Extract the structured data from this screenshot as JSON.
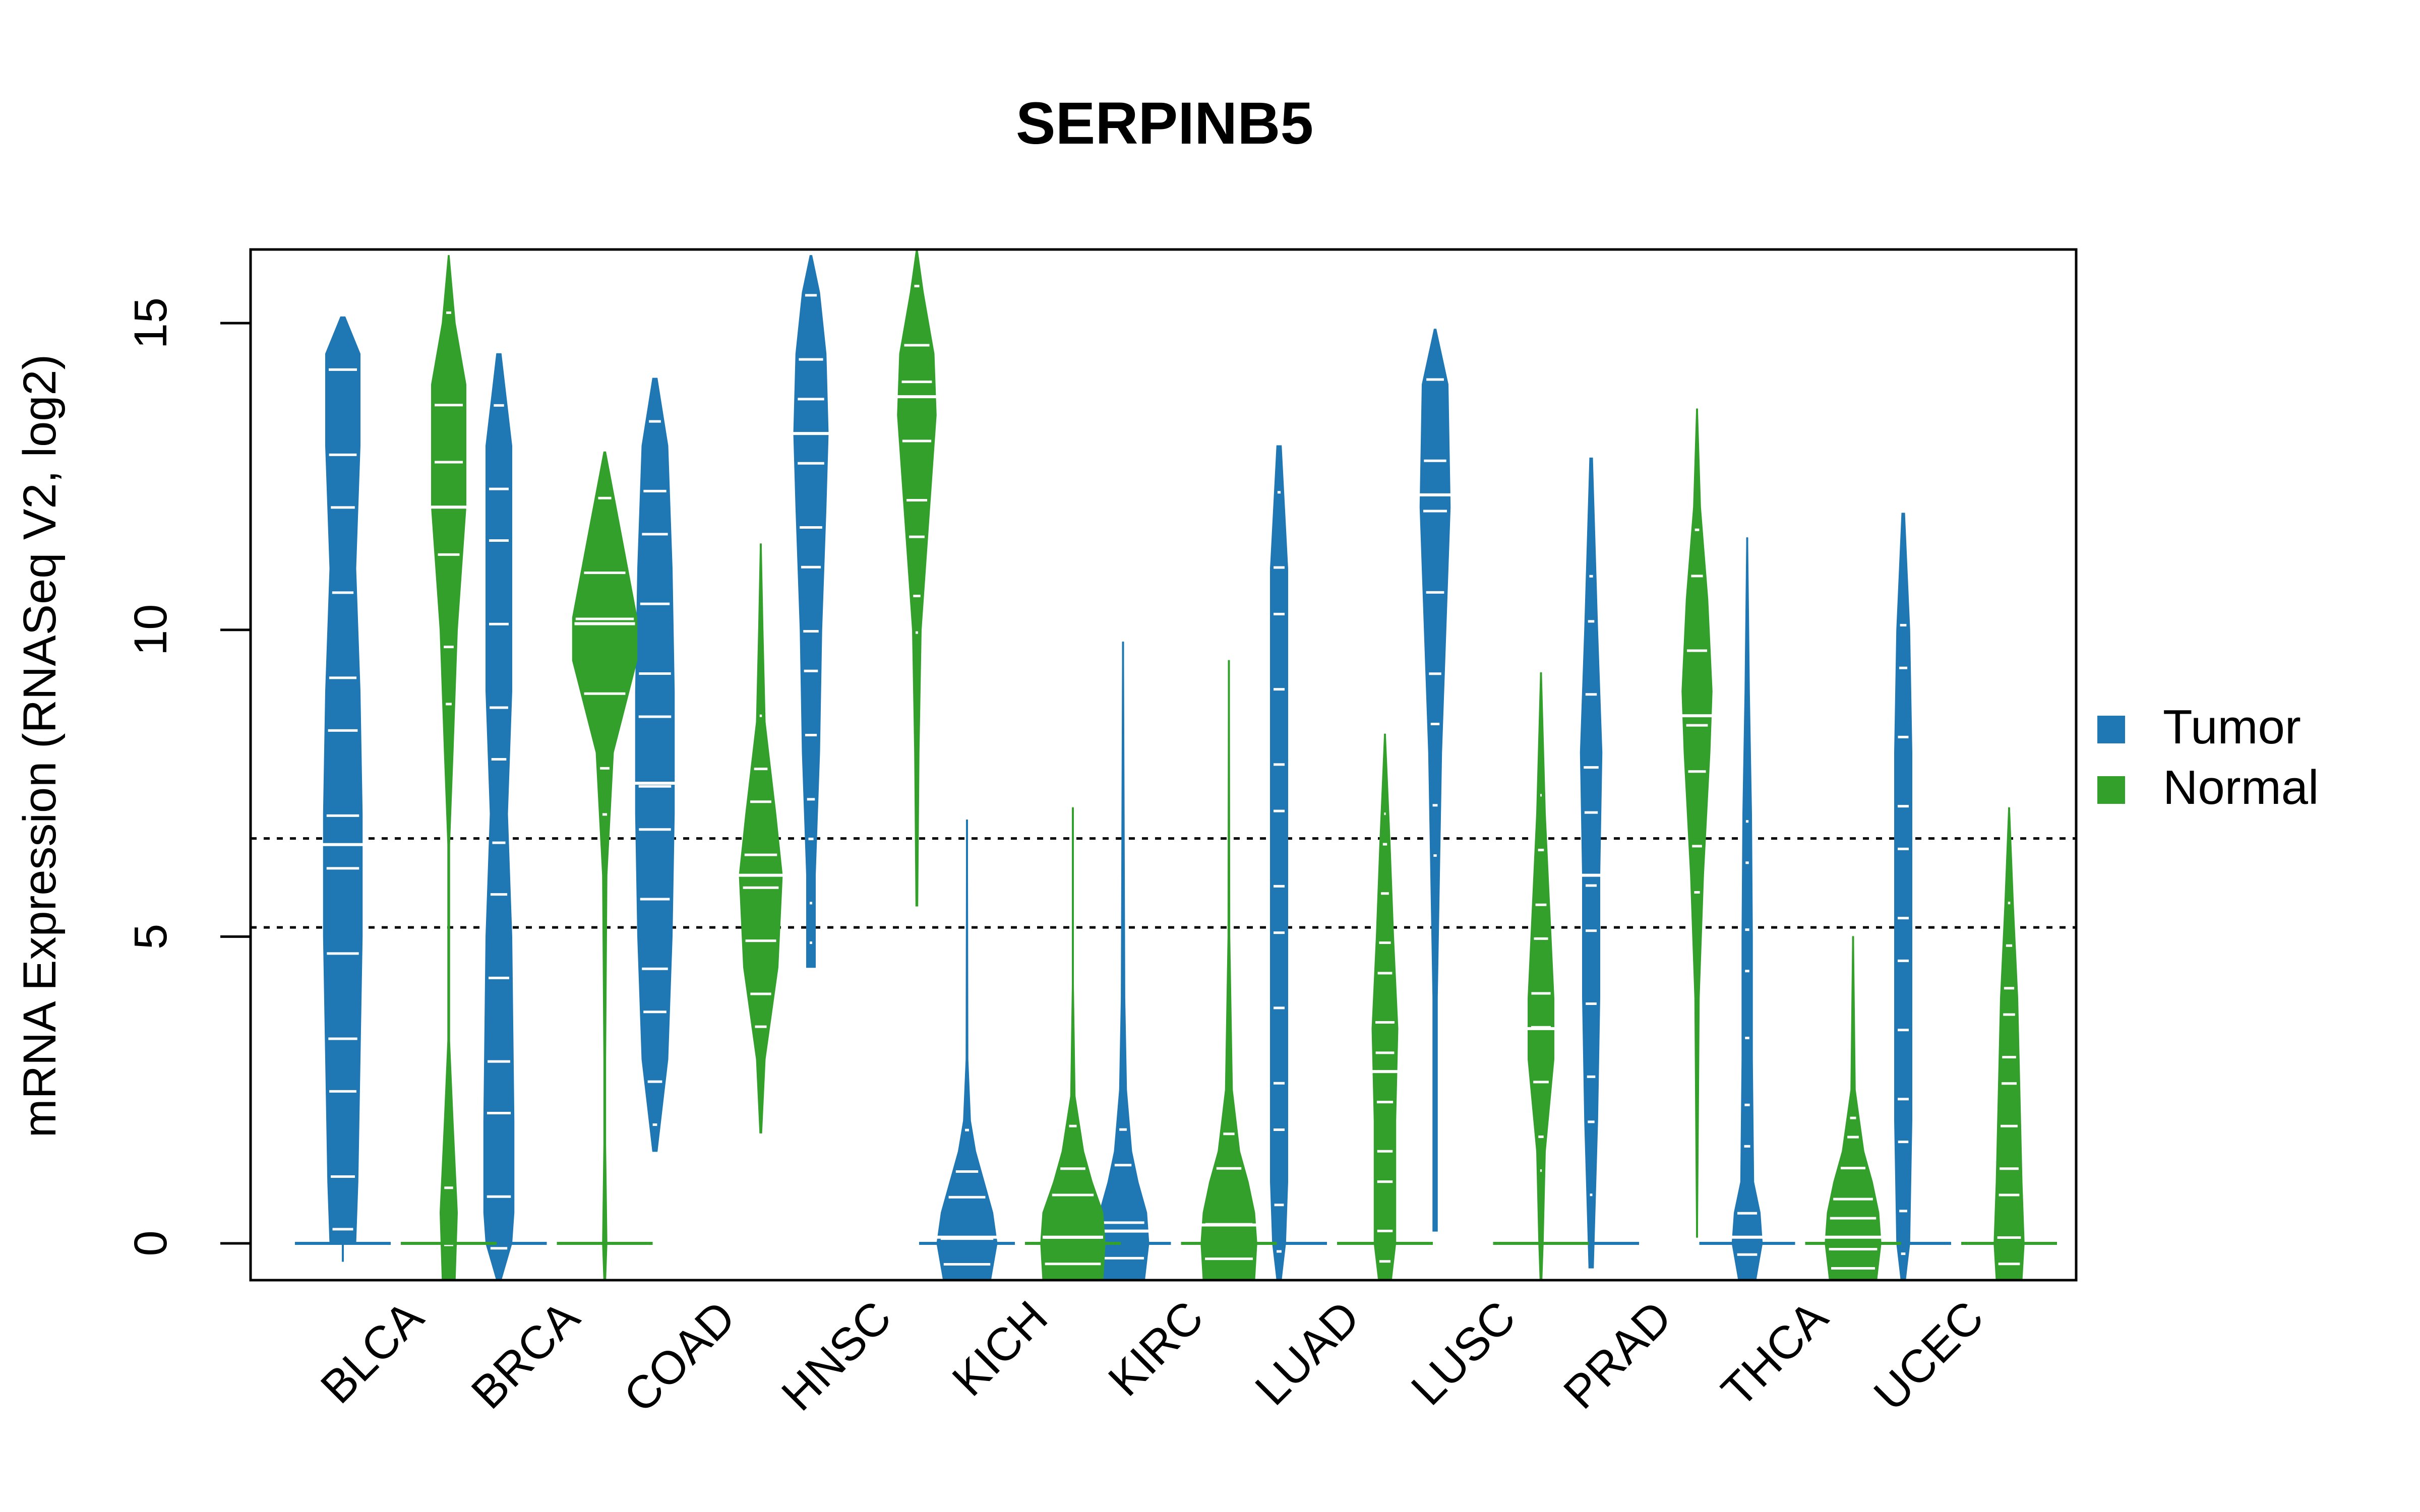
{
  "chart_data": {
    "type": "violin",
    "title": "SERPINB5",
    "xlabel": "",
    "ylabel": "mRNA Expression (RNASeq V2, log2)",
    "ylim": [
      -0.6,
      16.2
    ],
    "yticks": [
      0,
      5,
      10,
      15
    ],
    "grid": false,
    "legend": {
      "position": "right",
      "entries": [
        {
          "label": "Tumor",
          "color": "#1F77B4"
        },
        {
          "label": "Normal",
          "color": "#33A02C"
        }
      ]
    },
    "reference_lines": [
      {
        "y": 6.6,
        "style": "dotted"
      },
      {
        "y": 5.15,
        "style": "dotted"
      }
    ],
    "categories": [
      "BLCA",
      "BRCA",
      "COAD",
      "HNSC",
      "KICH",
      "KIRC",
      "LUAD",
      "LUSC",
      "PRAD",
      "THCA",
      "UCEC"
    ],
    "series": [
      {
        "name": "Tumor",
        "color": "#1F77B4",
        "violins": [
          {
            "min": -0.3,
            "max": 15.1,
            "median": 6.5,
            "profile": [
              [
                0,
                0.3
              ],
              [
                1,
                0.35
              ],
              [
                3,
                0.4
              ],
              [
                5,
                0.45
              ],
              [
                7,
                0.45
              ],
              [
                9,
                0.4
              ],
              [
                11,
                0.3
              ],
              [
                13,
                0.4
              ],
              [
                14.5,
                0.4
              ],
              [
                15.1,
                0.05
              ]
            ]
          },
          {
            "min": -0.6,
            "max": 14.5,
            "median": 0.0,
            "profile": [
              [
                -0.6,
                0.05
              ],
              [
                0,
                0.3
              ],
              [
                0.5,
                0.35
              ],
              [
                2,
                0.35
              ],
              [
                5,
                0.3
              ],
              [
                7,
                0.2
              ],
              [
                9,
                0.3
              ],
              [
                11,
                0.3
              ],
              [
                13,
                0.3
              ],
              [
                14.5,
                0.05
              ]
            ]
          },
          {
            "min": 1.5,
            "max": 14.1,
            "median": 7.5,
            "profile": [
              [
                1.5,
                0.05
              ],
              [
                3,
                0.3
              ],
              [
                5,
                0.4
              ],
              [
                7,
                0.45
              ],
              [
                9,
                0.45
              ],
              [
                11,
                0.4
              ],
              [
                13,
                0.3
              ],
              [
                14.1,
                0.05
              ]
            ]
          },
          {
            "min": 4.5,
            "max": 16.1,
            "median": 13.2,
            "profile": [
              [
                4.5,
                0.1
              ],
              [
                6,
                0.1
              ],
              [
                8,
                0.2
              ],
              [
                10,
                0.25
              ],
              [
                12,
                0.35
              ],
              [
                13.2,
                0.4
              ],
              [
                14.5,
                0.35
              ],
              [
                15.5,
                0.2
              ],
              [
                16.1,
                0.02
              ]
            ]
          },
          {
            "min": -0.6,
            "max": 6.9,
            "median": 0.1,
            "profile": [
              [
                -0.6,
                0.55
              ],
              [
                0,
                0.7
              ],
              [
                0.5,
                0.6
              ],
              [
                1,
                0.4
              ],
              [
                1.5,
                0.2
              ],
              [
                2,
                0.08
              ],
              [
                3,
                0.02
              ],
              [
                6.9,
                0.01
              ]
            ]
          },
          {
            "min": -0.6,
            "max": 9.8,
            "median": 0.2,
            "profile": [
              [
                -0.6,
                0.5
              ],
              [
                0,
                0.6
              ],
              [
                0.5,
                0.55
              ],
              [
                1,
                0.35
              ],
              [
                1.5,
                0.2
              ],
              [
                2.5,
                0.08
              ],
              [
                4,
                0.04
              ],
              [
                9.8,
                0.01
              ]
            ]
          },
          {
            "min": -0.6,
            "max": 13.0,
            "median": 0.0,
            "profile": [
              [
                -0.6,
                0.05
              ],
              [
                0,
                0.15
              ],
              [
                1,
                0.2
              ],
              [
                3,
                0.2
              ],
              [
                5,
                0.2
              ],
              [
                7,
                0.2
              ],
              [
                9,
                0.2
              ],
              [
                11,
                0.2
              ],
              [
                13,
                0.05
              ]
            ]
          },
          {
            "min": 0.2,
            "max": 14.9,
            "median": 12.2,
            "profile": [
              [
                0.2,
                0.05
              ],
              [
                2,
                0.05
              ],
              [
                4,
                0.05
              ],
              [
                6,
                0.1
              ],
              [
                8,
                0.15
              ],
              [
                10,
                0.25
              ],
              [
                12,
                0.35
              ],
              [
                14,
                0.3
              ],
              [
                14.9,
                0.02
              ]
            ]
          },
          {
            "min": -0.4,
            "max": 12.8,
            "median": 6.0,
            "profile": [
              [
                -0.4,
                0.05
              ],
              [
                2,
                0.15
              ],
              [
                4,
                0.2
              ],
              [
                6,
                0.2
              ],
              [
                8,
                0.25
              ],
              [
                10,
                0.15
              ],
              [
                12.8,
                0.03
              ]
            ]
          },
          {
            "min": -0.6,
            "max": 11.5,
            "median": 0.1,
            "profile": [
              [
                -0.6,
                0.2
              ],
              [
                0,
                0.35
              ],
              [
                0.5,
                0.3
              ],
              [
                1,
                0.15
              ],
              [
                3,
                0.12
              ],
              [
                5,
                0.12
              ],
              [
                7,
                0.1
              ],
              [
                9,
                0.05
              ],
              [
                11.5,
                0.01
              ]
            ]
          },
          {
            "min": -0.6,
            "max": 11.9,
            "median": 0.0,
            "profile": [
              [
                -0.6,
                0.05
              ],
              [
                0,
                0.15
              ],
              [
                2,
                0.2
              ],
              [
                4,
                0.2
              ],
              [
                6,
                0.2
              ],
              [
                8,
                0.2
              ],
              [
                10,
                0.15
              ],
              [
                11.9,
                0.03
              ]
            ]
          }
        ]
      },
      {
        "name": "Normal",
        "color": "#33A02C",
        "violins": [
          {
            "min": -0.6,
            "max": 16.1,
            "median": 12.0,
            "profile": [
              [
                -0.6,
                0.15
              ],
              [
                0.5,
                0.2
              ],
              [
                2,
                0.1
              ],
              [
                3.3,
                0.02
              ],
              [
                6.5,
                0.02
              ],
              [
                8,
                0.1
              ],
              [
                10,
                0.2
              ],
              [
                12,
                0.4
              ],
              [
                14,
                0.4
              ],
              [
                15,
                0.15
              ],
              [
                16.1,
                0.01
              ]
            ]
          },
          {
            "min": -0.6,
            "max": 12.9,
            "median": 10.1,
            "profile": [
              [
                -0.6,
                0.02
              ],
              [
                0,
                0.05
              ],
              [
                1.6,
                0.02
              ],
              [
                3,
                0.02
              ],
              [
                6,
                0.05
              ],
              [
                8,
                0.2
              ],
              [
                9.5,
                0.75
              ],
              [
                10.2,
                0.75
              ],
              [
                11.5,
                0.4
              ],
              [
                12.9,
                0.02
              ]
            ]
          },
          {
            "min": 1.8,
            "max": 11.4,
            "median": 6.0,
            "profile": [
              [
                1.8,
                0.02
              ],
              [
                3,
                0.1
              ],
              [
                4.5,
                0.4
              ],
              [
                6,
                0.5
              ],
              [
                7,
                0.35
              ],
              [
                8.5,
                0.1
              ],
              [
                10,
                0.05
              ],
              [
                11.4,
                0.01
              ]
            ]
          },
          {
            "min": 5.5,
            "max": 16.2,
            "median": 13.8,
            "profile": [
              [
                5.5,
                0.02
              ],
              [
                8,
                0.05
              ],
              [
                10,
                0.1
              ],
              [
                12,
                0.3
              ],
              [
                13.5,
                0.45
              ],
              [
                14.5,
                0.4
              ],
              [
                15.5,
                0.15
              ],
              [
                16.2,
                0.01
              ]
            ]
          },
          {
            "min": -0.6,
            "max": 7.1,
            "median": 0.1,
            "profile": [
              [
                -0.6,
                0.7
              ],
              [
                0,
                0.75
              ],
              [
                0.5,
                0.7
              ],
              [
                1,
                0.45
              ],
              [
                1.5,
                0.25
              ],
              [
                2.4,
                0.05
              ],
              [
                4.3,
                0.01
              ],
              [
                7.1,
                0.01
              ]
            ]
          },
          {
            "min": -0.6,
            "max": 9.5,
            "median": 0.3,
            "profile": [
              [
                -0.6,
                0.6
              ],
              [
                0,
                0.65
              ],
              [
                0.5,
                0.6
              ],
              [
                1,
                0.45
              ],
              [
                1.5,
                0.25
              ],
              [
                2.5,
                0.08
              ],
              [
                5,
                0.02
              ],
              [
                9.5,
                0.01
              ]
            ]
          },
          {
            "min": -0.6,
            "max": 8.3,
            "median": 2.8,
            "profile": [
              [
                -0.6,
                0.15
              ],
              [
                0,
                0.25
              ],
              [
                2,
                0.25
              ],
              [
                3.5,
                0.3
              ],
              [
                5,
                0.2
              ],
              [
                6.5,
                0.12
              ],
              [
                8.3,
                0.01
              ]
            ]
          },
          {
            "min": -0.6,
            "max": 9.3,
            "median": 3.5,
            "profile": [
              [
                -0.6,
                0.02
              ],
              [
                0,
                0.05
              ],
              [
                1.5,
                0.1
              ],
              [
                3,
                0.3
              ],
              [
                4,
                0.3
              ],
              [
                5.5,
                0.2
              ],
              [
                7,
                0.1
              ],
              [
                9.3,
                0.01
              ]
            ]
          },
          {
            "min": 0.1,
            "max": 13.6,
            "median": 8.6,
            "profile": [
              [
                0.1,
                0.01
              ],
              [
                2,
                0.03
              ],
              [
                4,
                0.05
              ],
              [
                6,
                0.15
              ],
              [
                8,
                0.3
              ],
              [
                9,
                0.35
              ],
              [
                10.5,
                0.25
              ],
              [
                12,
                0.08
              ],
              [
                13.6,
                0.01
              ]
            ]
          },
          {
            "min": -0.6,
            "max": 5.0,
            "median": 0.1,
            "profile": [
              [
                -0.6,
                0.55
              ],
              [
                0,
                0.65
              ],
              [
                0.5,
                0.6
              ],
              [
                1,
                0.45
              ],
              [
                1.5,
                0.25
              ],
              [
                2.5,
                0.05
              ],
              [
                5,
                0.01
              ]
            ]
          },
          {
            "min": -0.6,
            "max": 7.1,
            "median": 0.0,
            "profile": [
              [
                -0.6,
                0.3
              ],
              [
                0,
                0.35
              ],
              [
                1,
                0.3
              ],
              [
                2.5,
                0.25
              ],
              [
                4,
                0.2
              ],
              [
                5.5,
                0.1
              ],
              [
                7.1,
                0.01
              ]
            ]
          }
        ]
      }
    ]
  }
}
